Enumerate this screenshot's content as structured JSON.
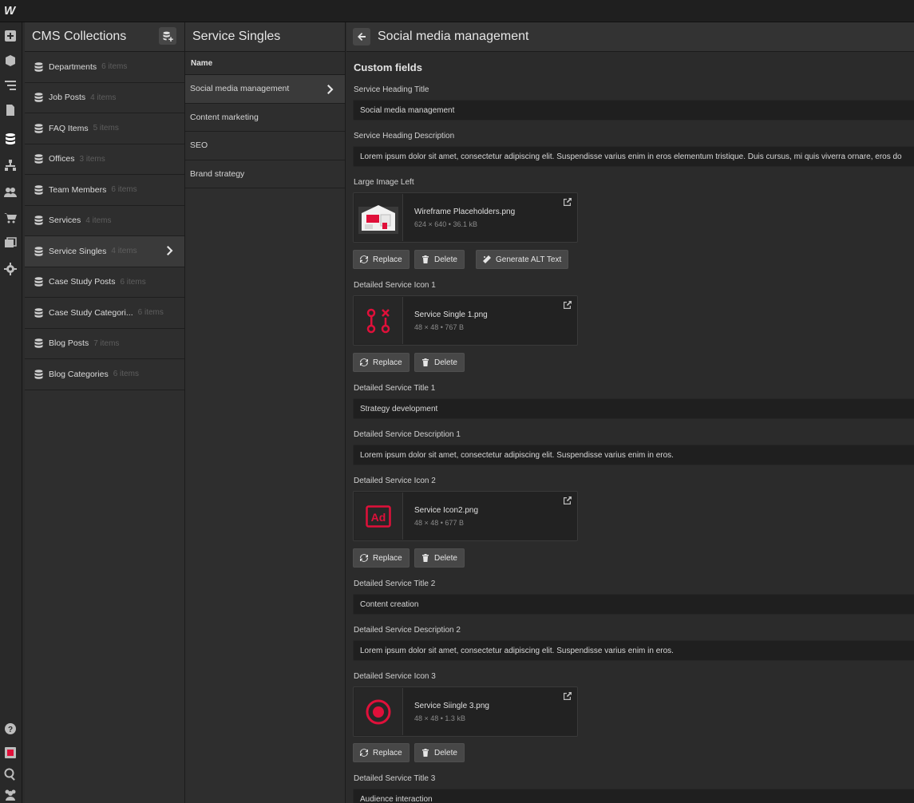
{
  "app": {
    "logo": "W"
  },
  "leftbar": {
    "icons": [
      "add-icon",
      "box-icon",
      "navigator-icon",
      "pages-icon",
      "cms-icon",
      "logic-icon",
      "users-icon",
      "ecommerce-icon",
      "assets-icon",
      "settings-icon",
      "help-icon",
      "record-icon",
      "search-icon",
      "collaborators-icon"
    ]
  },
  "collections": {
    "title": "CMS Collections",
    "items": [
      {
        "name": "Departments",
        "count": "6 items"
      },
      {
        "name": "Job Posts",
        "count": "4 items"
      },
      {
        "name": "FAQ Items",
        "count": "5 items"
      },
      {
        "name": "Offices",
        "count": "3 items"
      },
      {
        "name": "Team Members",
        "count": "6 items"
      },
      {
        "name": "Services",
        "count": "4 items"
      },
      {
        "name": "Service Singles",
        "count": "4 items",
        "selected": true
      },
      {
        "name": "Case Study Posts",
        "count": "6 items"
      },
      {
        "name": "Case Study Categori...",
        "count": "6 items"
      },
      {
        "name": "Blog Posts",
        "count": "7 items"
      },
      {
        "name": "Blog Categories",
        "count": "6 items"
      }
    ]
  },
  "items_panel": {
    "title": "Service Singles",
    "column": "Name",
    "rows": [
      "Social media management",
      "Content marketing",
      "SEO",
      "Brand strategy"
    ]
  },
  "editor": {
    "title": "Social media management",
    "section": "Custom fields",
    "fields": {
      "heading_title_label": "Service Heading Title",
      "heading_title_value": "Social media management",
      "heading_desc_label": "Service Heading Description",
      "heading_desc_value": "Lorem ipsum dolor sit amet, consectetur adipiscing elit. Suspendisse varius enim in eros elementum tristique. Duis cursus, mi quis viverra ornare, eros do",
      "large_image_label": "Large Image Left",
      "large_image_name": "Wireframe Placeholders.png",
      "large_image_meta": "624 × 640 • 36.1 kB",
      "icon1_label": "Detailed Service Icon 1",
      "icon1_name": "Service Single 1.png",
      "icon1_meta": "48 × 48 • 767 B",
      "title1_label": "Detailed Service Title 1",
      "title1_value": "Strategy development",
      "desc1_label": "Detailed Service Description 1",
      "desc1_value": "Lorem ipsum dolor sit amet, consectetur adipiscing elit. Suspendisse varius enim in eros.",
      "icon2_label": "Detailed Service Icon 2",
      "icon2_name": "Service Icon2.png",
      "icon2_meta": "48 × 48 • 677 B",
      "title2_label": "Detailed Service Title 2",
      "title2_value": "Content creation",
      "desc2_label": "Detailed Service Description 2",
      "desc2_value": "Lorem ipsum dolor sit amet, consectetur adipiscing elit. Suspendisse varius enim in eros.",
      "icon3_label": "Detailed Service Icon 3",
      "icon3_name": "Service Siingle 3.png",
      "icon3_meta": "48 × 48 • 1.3 kB",
      "title3_label": "Detailed Service Title 3",
      "title3_value": "Audience interaction"
    },
    "buttons": {
      "replace": "Replace",
      "delete": "Delete",
      "generate_alt": "Generate ALT Text"
    },
    "accent_color": "#e0103a"
  }
}
